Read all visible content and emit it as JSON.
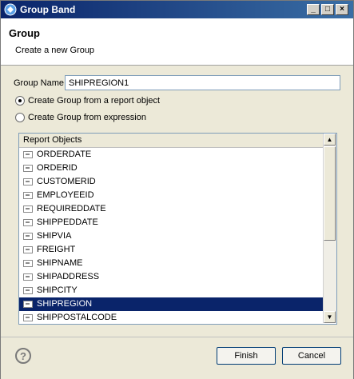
{
  "window": {
    "title": "Group Band",
    "controls": {
      "minimize": "_",
      "maximize": "□",
      "close": "×"
    }
  },
  "header": {
    "title": "Group",
    "subtitle": "Create a new Group"
  },
  "form": {
    "group_name_label": "Group Name",
    "group_name_value": "SHIPREGION1",
    "radio_report_object": "Create Group from a report object",
    "radio_expression": "Create Group from expression",
    "selected_radio": "report_object"
  },
  "report_objects": {
    "header": "Report Objects",
    "items": [
      "ORDERDATE",
      "ORDERID",
      "CUSTOMERID",
      "EMPLOYEEID",
      "REQUIREDDATE",
      "SHIPPEDDATE",
      "SHIPVIA",
      "FREIGHT",
      "SHIPNAME",
      "SHIPADDRESS",
      "SHIPCITY",
      "SHIPREGION",
      "SHIPPOSTALCODE"
    ],
    "selected": "SHIPREGION"
  },
  "footer": {
    "help": "?",
    "finish": "Finish",
    "cancel": "Cancel"
  },
  "icons": {
    "app": "app-logo-icon",
    "field": "field-icon",
    "help": "help-icon"
  }
}
